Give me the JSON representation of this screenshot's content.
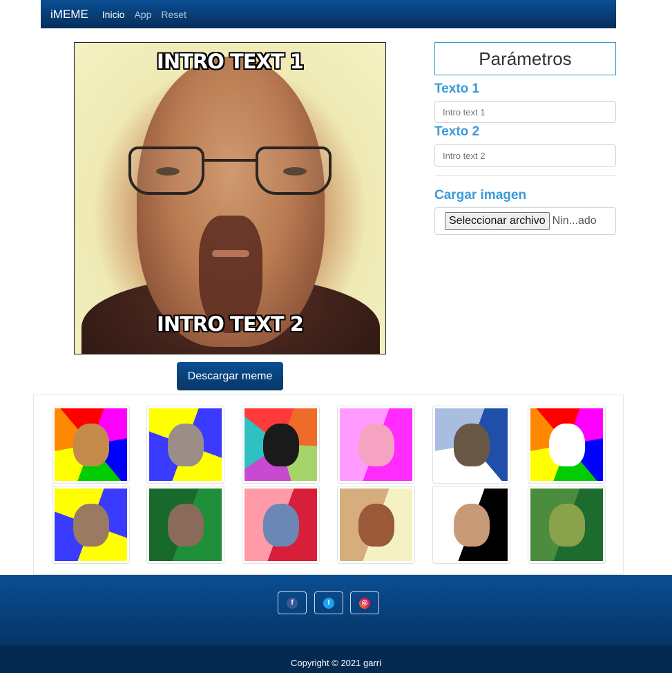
{
  "navbar": {
    "brand": "iMEME",
    "links": [
      "Inicio",
      "App",
      "Reset"
    ]
  },
  "meme": {
    "top_text": "INTRO TEXT 1",
    "bottom_text": "INTRO TEXT 2"
  },
  "download_label": "Descargar meme",
  "params": {
    "title": "Parámetros",
    "text1_label": "Texto 1",
    "text1_placeholder": "Intro text 1",
    "text2_label": "Texto 2",
    "text2_placeholder": "Intro text 2",
    "image_label": "Cargar imagen",
    "file_button": "Seleccionar archivo",
    "file_status": "Nin...ado"
  },
  "gallery": {
    "templates": [
      {
        "name": "advice-dog",
        "colors": [
          "#ff00ff",
          "#0000ff",
          "#00cc00",
          "#ffff00",
          "#ff8800",
          "#ff0000"
        ],
        "figure": "#c48a4c"
      },
      {
        "name": "advice-god",
        "colors": [
          "#3b3bff",
          "#ffff00",
          "#3b3bff",
          "#ffff00"
        ],
        "figure": "#9a8e86"
      },
      {
        "name": "business-cat",
        "colors": [
          "#f06a2a",
          "#a7d46a",
          "#c84ad1",
          "#2fc0c0",
          "#ff3a3a"
        ],
        "figure": "#1a1a1a"
      },
      {
        "name": "slowpoke",
        "colors": [
          "#ff2bff",
          "#ff9bff"
        ],
        "figure": "#f5a3c0"
      },
      {
        "name": "socially-awkward-penguin",
        "colors": [
          "#1f4faa",
          "#ffffff",
          "#a9bde0"
        ],
        "figure": "#6a5846"
      },
      {
        "name": "reddit-alien",
        "colors": [
          "#ff00ff",
          "#0000ff",
          "#00cc00",
          "#ffff00",
          "#ff8800",
          "#ff0000"
        ],
        "figure": "#ffffff"
      },
      {
        "name": "scumbag-god",
        "colors": [
          "#3b3bff",
          "#ffff00",
          "#3b3bff",
          "#ffff00"
        ],
        "figure": "#9a7a60"
      },
      {
        "name": "high-expectations-asian-father",
        "colors": [
          "#1f8f3a",
          "#176a2c"
        ],
        "figure": "#8a6a58"
      },
      {
        "name": "dating-site-murderer",
        "colors": [
          "#d71f3a",
          "#ff9aa8"
        ],
        "figure": "#6a87b5"
      },
      {
        "name": "walter-white",
        "colors": [
          "#f4f2c3",
          "#d6ad7c"
        ],
        "figure": "#9a5a3a"
      },
      {
        "name": "scumbag-steve",
        "colors": [
          "#000000",
          "#ffffff"
        ],
        "figure": "#c99a78"
      },
      {
        "name": "foul-bachelor-frog",
        "colors": [
          "#1e6b30",
          "#4c8c3e"
        ],
        "figure": "#8aa24a"
      }
    ]
  },
  "footer": {
    "social": [
      {
        "name": "facebook",
        "glyph": "f",
        "color": "#3b5998"
      },
      {
        "name": "twitter",
        "glyph": "t",
        "color": "#1da1f2"
      },
      {
        "name": "instagram",
        "glyph": "◎",
        "color": "#d6249f"
      }
    ],
    "copyright": "Copyright © 2021 garri"
  }
}
